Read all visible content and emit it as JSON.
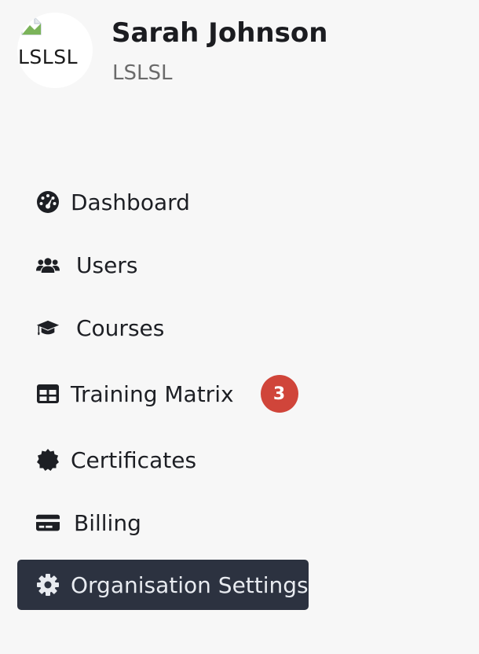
{
  "profile": {
    "name": "Sarah Johnson",
    "organisation": "LSLSL",
    "avatar_alt": "LSLSL"
  },
  "nav": {
    "items": [
      {
        "label": "Dashboard",
        "icon": "dashboard-gauge-icon"
      },
      {
        "label": "Users",
        "icon": "users-icon"
      },
      {
        "label": "Courses",
        "icon": "graduation-cap-icon"
      },
      {
        "label": "Training Matrix",
        "icon": "table-icon",
        "badge": "3"
      },
      {
        "label": "Certificates",
        "icon": "certificate-icon"
      },
      {
        "label": "Billing",
        "icon": "credit-card-icon"
      },
      {
        "label": "Organisation Settings",
        "icon": "gear-icon",
        "active": true
      }
    ]
  },
  "colors": {
    "background": "#f7f7f7",
    "active_item_background": "#2c3240",
    "active_item_text": "#e8ebf0",
    "badge_background": "#d0453a",
    "text": "#1d1f24",
    "muted_text": "#6b6b6b"
  }
}
